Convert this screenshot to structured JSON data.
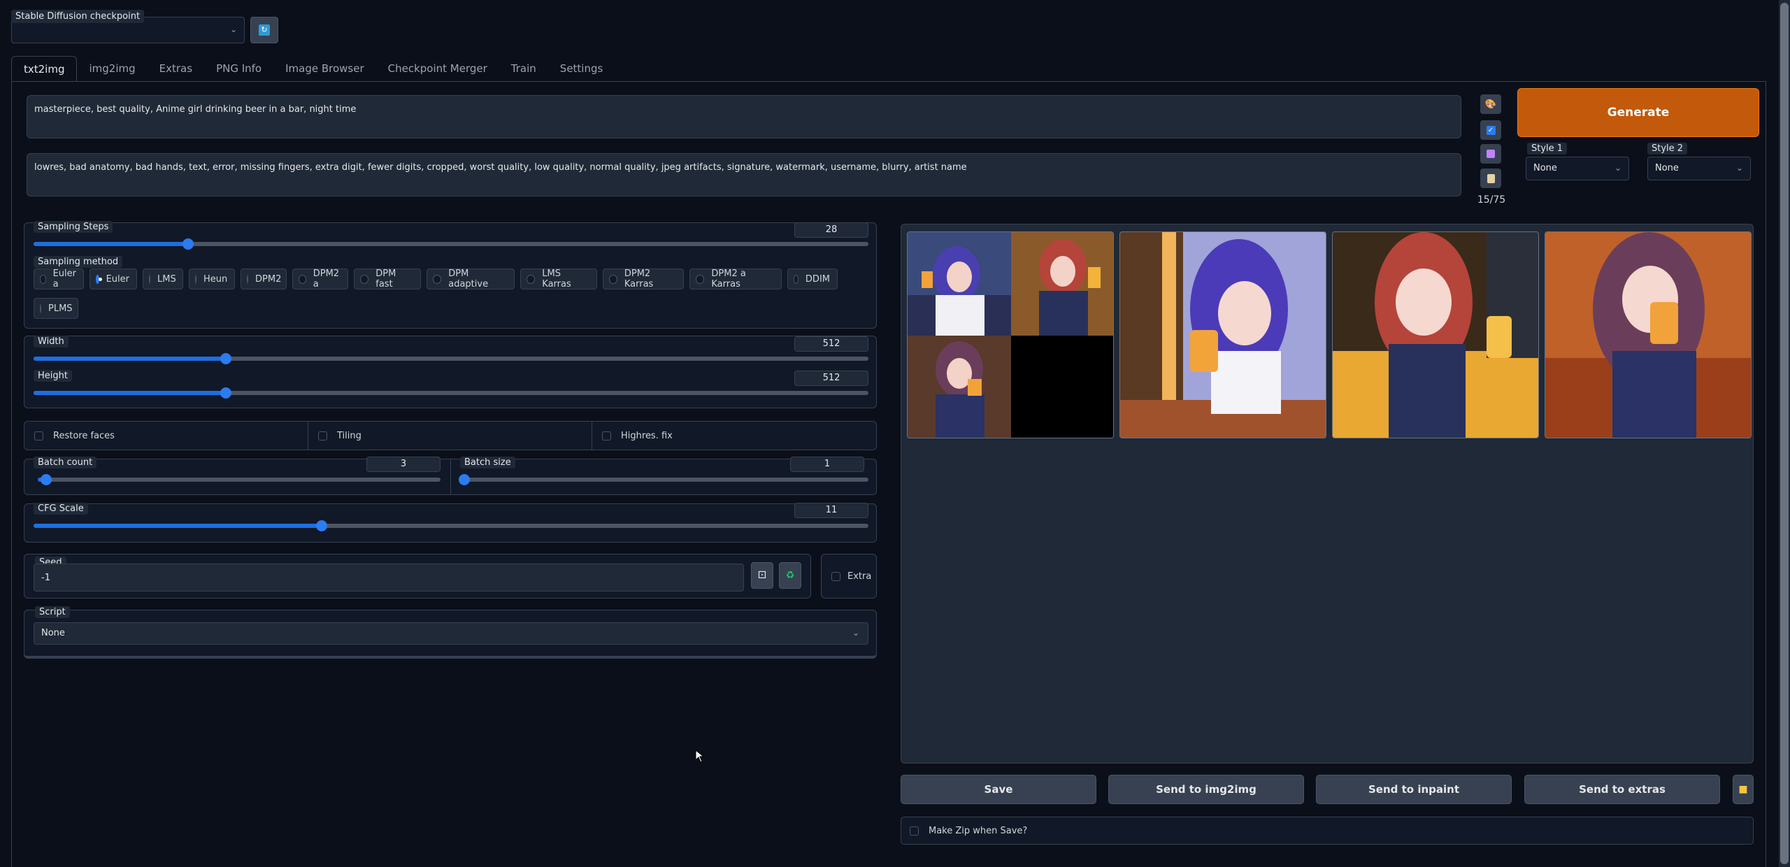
{
  "checkpoint": {
    "label": "Stable Diffusion checkpoint",
    "value": ""
  },
  "tabs": [
    {
      "label": "txt2img",
      "active": true
    },
    {
      "label": "img2img"
    },
    {
      "label": "Extras"
    },
    {
      "label": "PNG Info"
    },
    {
      "label": "Image Browser"
    },
    {
      "label": "Checkpoint Merger"
    },
    {
      "label": "Train"
    },
    {
      "label": "Settings"
    }
  ],
  "prompt": "masterpiece, best quality, Anime girl drinking beer in a bar, night time",
  "negative_prompt": "lowres, bad anatomy, bad hands, text, error, missing fingers, extra digit, fewer digits, cropped, worst quality, low quality, normal quality, jpeg artifacts, signature, watermark, username, blurry, artist name",
  "token_count": "15/75",
  "generate_label": "Generate",
  "styles": [
    {
      "label": "Style 1",
      "value": "None"
    },
    {
      "label": "Style 2",
      "value": "None"
    }
  ],
  "sampling": {
    "steps_label": "Sampling Steps",
    "steps": "28",
    "steps_fraction": 0.185,
    "method_label": "Sampling method",
    "methods": [
      "Euler a",
      "Euler",
      "LMS",
      "Heun",
      "DPM2",
      "DPM2 a",
      "DPM fast",
      "DPM adaptive",
      "LMS Karras",
      "DPM2 Karras",
      "DPM2 a Karras",
      "DDIM",
      "PLMS"
    ],
    "selected": "Euler"
  },
  "size": {
    "width_label": "Width",
    "width": "512",
    "width_fraction": 0.23,
    "height_label": "Height",
    "height": "512",
    "height_fraction": 0.23
  },
  "options": {
    "restore_faces": "Restore faces",
    "tiling": "Tiling",
    "highres": "Highres. fix"
  },
  "batch": {
    "count_label": "Batch count",
    "count": "3",
    "count_fraction": 0.02,
    "size_label": "Batch size",
    "size": "1",
    "size_fraction": 0.0
  },
  "cfg": {
    "label": "CFG Scale",
    "value": "11",
    "fraction": 0.345
  },
  "seed": {
    "label": "Seed",
    "value": "-1",
    "extra_label": "Extra"
  },
  "script": {
    "label": "Script",
    "value": "None"
  },
  "output": {
    "save": "Save",
    "send_img2img": "Send to img2img",
    "send_inpaint": "Send to inpaint",
    "send_extras": "Send to extras",
    "make_zip": "Make Zip when Save?"
  },
  "colors": {
    "accent": "#2b7cf0",
    "generate": "#c2590b",
    "background": "#0b0f19"
  }
}
